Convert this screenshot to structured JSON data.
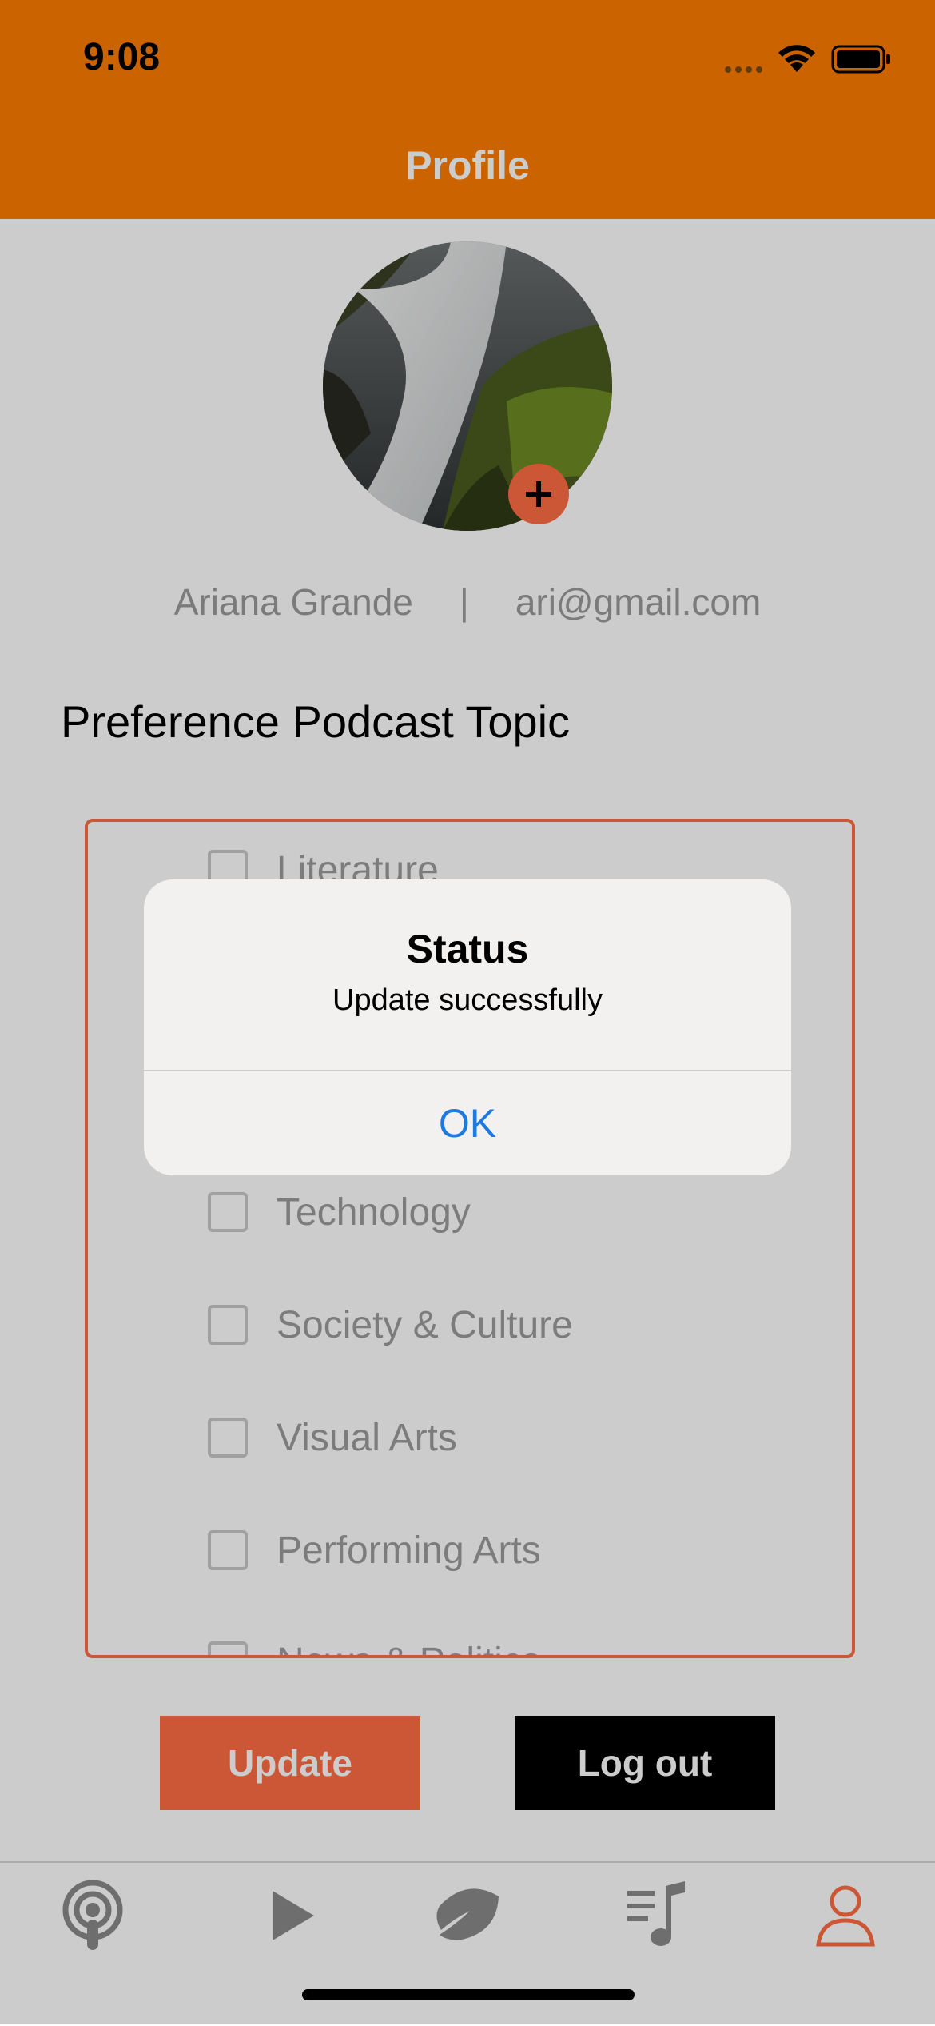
{
  "status_bar": {
    "time": "9:08"
  },
  "header": {
    "title": "Profile"
  },
  "profile": {
    "name": "Ariana Grande",
    "separator": "|",
    "email": "ari@gmail.com"
  },
  "section": {
    "title": "Preference Podcast Topic"
  },
  "topics": [
    {
      "label": "Literature",
      "checked": false
    },
    {
      "label": "Technology",
      "checked": false
    },
    {
      "label": "Society & Culture",
      "checked": false
    },
    {
      "label": "Visual Arts",
      "checked": false
    },
    {
      "label": "Performing Arts",
      "checked": false
    },
    {
      "label": "News & Politics",
      "checked": false
    }
  ],
  "buttons": {
    "update": "Update",
    "logout": "Log out"
  },
  "tabs": [
    {
      "icon": "podcast-icon",
      "active": false
    },
    {
      "icon": "play-icon",
      "active": false
    },
    {
      "icon": "leaf-icon",
      "active": false
    },
    {
      "icon": "playlist-icon",
      "active": false
    },
    {
      "icon": "profile-icon",
      "active": true
    }
  ],
  "alert": {
    "title": "Status",
    "message": "Update successfully",
    "ok": "OK"
  },
  "colors": {
    "header_bg": "#fe7c00",
    "accent": "#ff6d45",
    "alert_button": "#1e7ae0",
    "inactive_icon": "#8a8a8a"
  }
}
